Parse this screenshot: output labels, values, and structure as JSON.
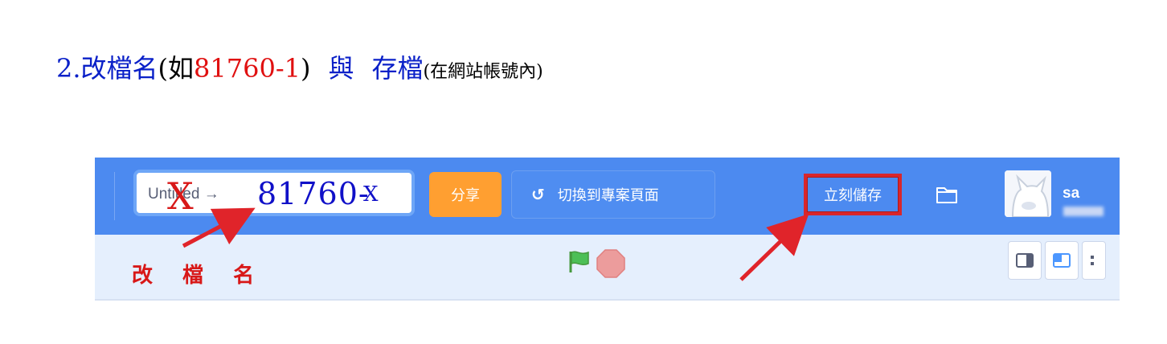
{
  "heading": {
    "step": "2.",
    "rename": "改檔名",
    "open_paren": "(如 ",
    "example": "81760-1",
    "close_paren": ")",
    "and": "與",
    "save": "存檔",
    "note": "(在網站帳號內)"
  },
  "menubar": {
    "project_title_old": "Untitled →",
    "project_title_new": "81760-",
    "project_title_cross": "X",
    "project_title_suffix": "X",
    "share_label": "分享",
    "switch_icon": "↺",
    "switch_label": "切換到專案頁面",
    "save_now_label": "立刻儲存",
    "username": "sa"
  },
  "annotations": {
    "rename_label": "改 檔 名"
  },
  "icons": {
    "folder": "folder-icon",
    "flag": "green-flag-icon",
    "stop": "stop-icon",
    "small_stage": "small-stage-icon",
    "normal_stage": "normal-stage-icon"
  },
  "colors": {
    "menubar": "#4c8af0",
    "share": "#ff9f31",
    "highlight": "#d8262c",
    "heading_blue": "#0a20c8",
    "heading_red": "#e01010"
  }
}
